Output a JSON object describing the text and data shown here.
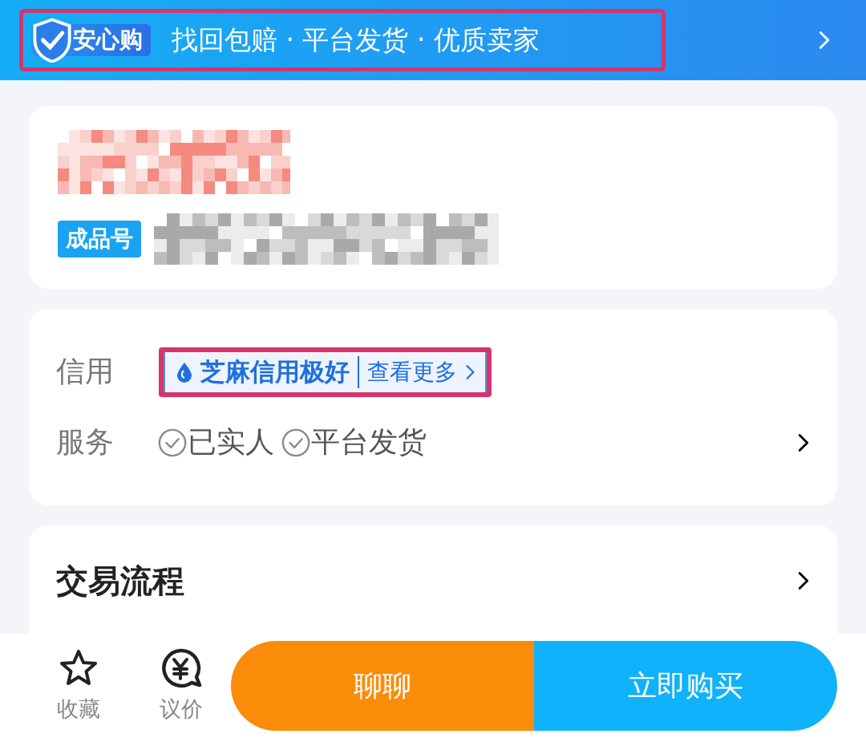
{
  "banner": {
    "badge": "安心购",
    "text": "找回包赔 · 平台发货 · 优质卖家",
    "highlighted": true
  },
  "listing": {
    "tag": "成品号"
  },
  "info": {
    "rows": [
      {
        "kind": "credit",
        "label": "信用",
        "value": "芝麻信用极好",
        "link": "查看更多",
        "highlighted": true
      },
      {
        "kind": "services",
        "label": "服务",
        "items": [
          "已实人",
          "平台发货"
        ]
      }
    ]
  },
  "process": {
    "title": "交易流程"
  },
  "bottom_bar": {
    "actions": [
      {
        "kind": "star",
        "label": "收藏"
      },
      {
        "kind": "price",
        "label": "议价"
      }
    ],
    "buttons": [
      {
        "kind": "chat",
        "label": "聊聊"
      },
      {
        "kind": "buy",
        "label": "立即购买"
      }
    ]
  }
}
